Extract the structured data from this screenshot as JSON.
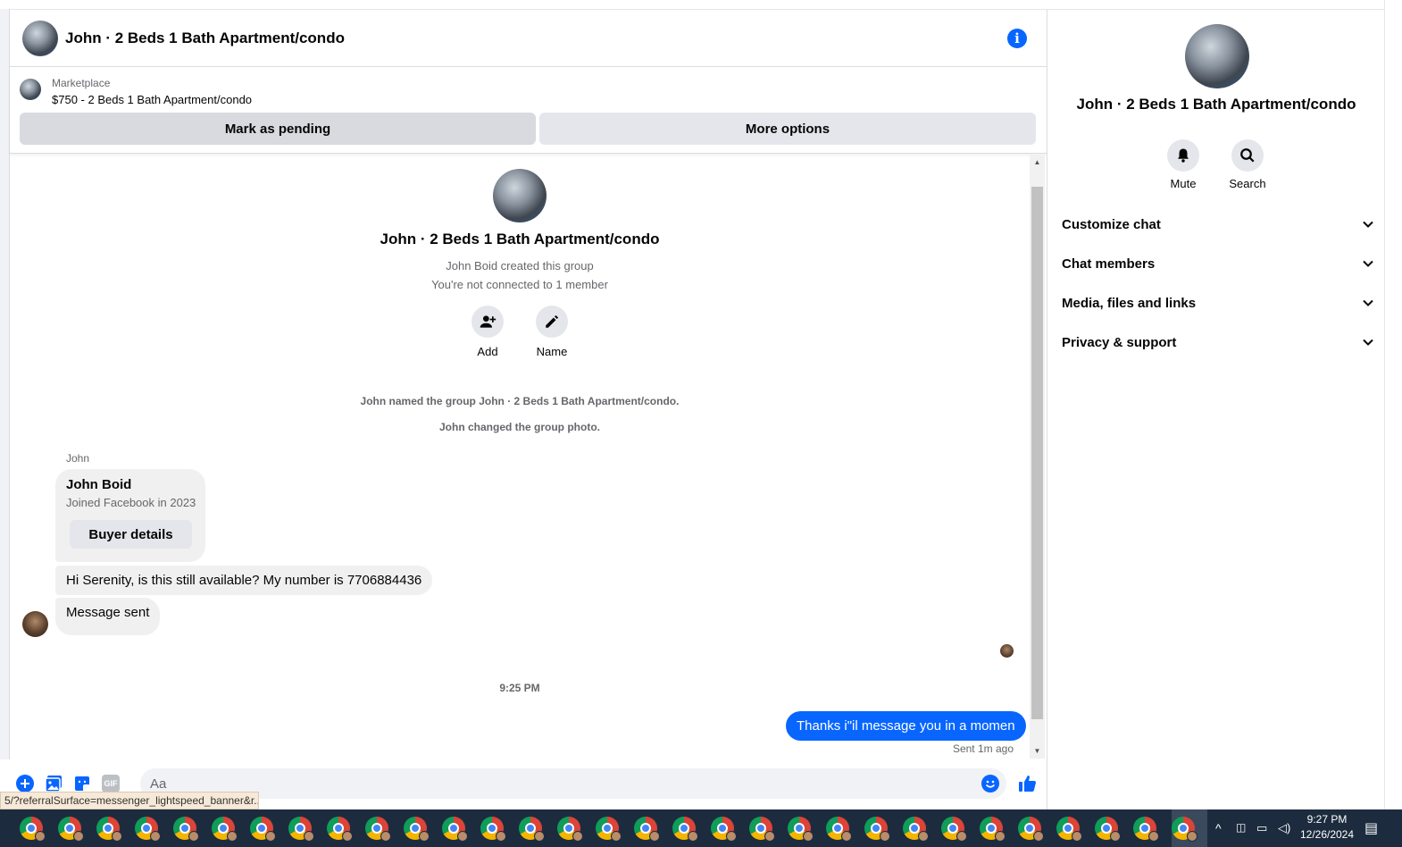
{
  "header": {
    "title": "John · 2 Beds 1 Bath Apartment/condo",
    "info_icon": "i"
  },
  "marketplace": {
    "label": "Marketplace",
    "listing": "$750 - 2 Beds 1 Bath Apartment/condo",
    "pending_button": "Mark as pending",
    "more_button": "More options"
  },
  "intro": {
    "title": "John · 2 Beds 1 Bath Apartment/condo",
    "created": "John Boid created this group",
    "connection": "You're not connected to 1 member",
    "add_label": "Add",
    "name_label": "Name"
  },
  "system_messages": [
    "John named the group John · 2 Beds 1 Bath Apartment/condo.",
    "John changed the group photo."
  ],
  "conversation": {
    "sender_name": "John",
    "buyer_card": {
      "name": "John Boid",
      "joined": "Joined Facebook in 2023",
      "button": "Buyer details"
    },
    "message_1": "Hi Serenity, is this still available? My  number is 7706884436",
    "message_2": "Message sent",
    "time_separator": "9:25 PM",
    "my_message": "Thanks i\"il message you in a momen",
    "sent_status": "Sent 1m ago"
  },
  "composer": {
    "placeholder": "Aa",
    "value": "",
    "gif_label": "GIF"
  },
  "tooltip_url": "5/?referralSurface=messenger_lightspeed_banner&r...",
  "right_panel": {
    "title": "John · 2 Beds 1 Bath Apartment/condo",
    "mute_label": "Mute",
    "search_label": "Search",
    "sections": [
      "Customize chat",
      "Chat members",
      "Media, files and links",
      "Privacy & support"
    ]
  },
  "taskbar": {
    "time": "9:27 PM",
    "date": "12/26/2024",
    "app_icon": "chrome-icon",
    "app_count": 31
  },
  "colors": {
    "accent": "#0866ff",
    "bubble": "#f0f0f0",
    "secondary_text": "#65676b",
    "taskbar": "#1c2c3e"
  }
}
